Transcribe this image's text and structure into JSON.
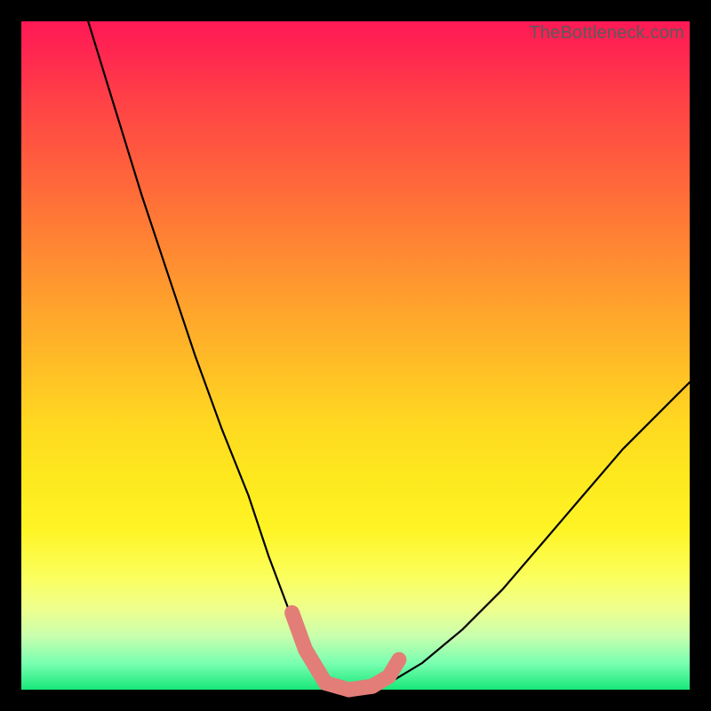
{
  "watermark": "TheBottleneck.com",
  "chart_data": {
    "type": "line",
    "title": "",
    "xlabel": "",
    "ylabel": "",
    "xlim": [
      0,
      100
    ],
    "ylim": [
      0,
      100
    ],
    "series": [
      {
        "name": "bottleneck-curve",
        "x": [
          10,
          14,
          18,
          22,
          26,
          30,
          34,
          37,
          40,
          42,
          44,
          46,
          48,
          50,
          52,
          55,
          60,
          66,
          72,
          78,
          84,
          90,
          96,
          100
        ],
        "values": [
          100,
          87,
          74,
          62,
          50,
          39,
          29,
          20,
          12,
          7,
          3,
          1,
          0,
          0,
          0,
          1,
          4,
          9,
          15,
          22,
          29,
          36,
          42,
          46
        ]
      }
    ],
    "markers": {
      "name": "highlight-segments",
      "color": "#e27e77",
      "points": [
        {
          "x": 40.5,
          "y": 11.5
        },
        {
          "x": 42.5,
          "y": 6.0
        },
        {
          "x": 45.5,
          "y": 1.0
        },
        {
          "x": 49.0,
          "y": 0.0
        },
        {
          "x": 52.5,
          "y": 0.5
        },
        {
          "x": 55.0,
          "y": 2.0
        },
        {
          "x": 56.5,
          "y": 4.5
        }
      ]
    },
    "background": {
      "type": "vertical-gradient",
      "stops": [
        {
          "pos": 0.0,
          "color": "#ff1955"
        },
        {
          "pos": 0.5,
          "color": "#ffb927"
        },
        {
          "pos": 0.83,
          "color": "#fbff5c"
        },
        {
          "pos": 1.0,
          "color": "#18e87a"
        }
      ]
    }
  }
}
